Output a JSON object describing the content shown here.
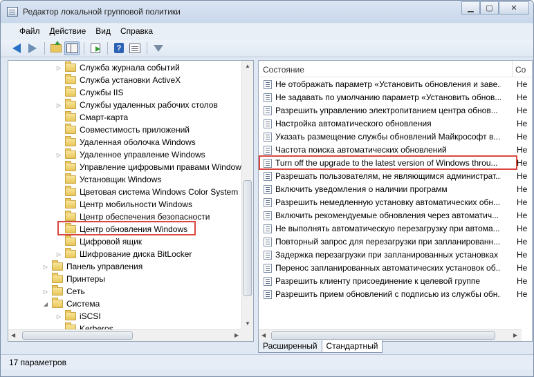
{
  "window": {
    "title": "Редактор локальной групповой политики",
    "minimize": "▁",
    "maximize": "▢",
    "close": "✕"
  },
  "menu": [
    "Файл",
    "Действие",
    "Вид",
    "Справка"
  ],
  "toolbar_icons": [
    "back-arrow-icon",
    "forward-arrow-icon",
    "up-folder-icon",
    "show-hide-tree-icon",
    "export-list-icon",
    "help-icon",
    "properties-icon",
    "filter-icon"
  ],
  "tree": [
    {
      "label": "Служба журнала событий",
      "expander": "▷"
    },
    {
      "label": "Служба установки ActiveX",
      "expander": ""
    },
    {
      "label": "Службы IIS",
      "expander": ""
    },
    {
      "label": "Службы удаленных рабочих столов",
      "expander": "▷"
    },
    {
      "label": "Смарт-карта",
      "expander": ""
    },
    {
      "label": "Совместимость приложений",
      "expander": ""
    },
    {
      "label": "Удаленная оболочка Windows",
      "expander": ""
    },
    {
      "label": "Удаленное управление Windows",
      "expander": "▷"
    },
    {
      "label": "Управление цифровыми правами Windows",
      "expander": ""
    },
    {
      "label": "Установщик Windows",
      "expander": ""
    },
    {
      "label": "Цветовая система Windows Color System",
      "expander": ""
    },
    {
      "label": "Центр мобильности Windows",
      "expander": ""
    },
    {
      "label": "Центр обеспечения безопасности",
      "expander": ""
    },
    {
      "label": "Центр обновления Windows",
      "expander": ""
    },
    {
      "label": "Цифровой ящик",
      "expander": ""
    },
    {
      "label": "Шифрование диска BitLocker",
      "expander": "▷"
    },
    {
      "label": "Панель управления",
      "expander": "▷"
    },
    {
      "label": "Принтеры",
      "expander": ""
    },
    {
      "label": "Сеть",
      "expander": "▷"
    },
    {
      "label": "Система",
      "expander": "◢"
    },
    {
      "label": "iSCSI",
      "expander": "▷"
    },
    {
      "label": "Kerberos",
      "expander": ""
    }
  ],
  "columns": {
    "name": "Состояние",
    "state": "Со"
  },
  "policies": [
    {
      "name": "Не отображать параметр «Установить обновления и заве...",
      "state": "Не"
    },
    {
      "name": "Не задавать по умолчанию параметр «Установить обнов...",
      "state": "Не"
    },
    {
      "name": "Разрешить управлению электропитанием центра обнов...",
      "state": "Не"
    },
    {
      "name": "Настройка автоматического обновления",
      "state": "Не"
    },
    {
      "name": "Указать размещение службы обновлений Майкрософт в...",
      "state": "Не"
    },
    {
      "name": "Частота поиска автоматических обновлений",
      "state": "Не"
    },
    {
      "name": "Turn off the upgrade to the latest version of Windows throu...",
      "state": "Не"
    },
    {
      "name": "Разрешать пользователям, не являющимся администрат...",
      "state": "Не"
    },
    {
      "name": "Включить уведомления о наличии программ",
      "state": "Не"
    },
    {
      "name": "Разрешить немедленную установку автоматических обн...",
      "state": "Не"
    },
    {
      "name": "Включить рекомендуемые обновления через автоматич...",
      "state": "Не"
    },
    {
      "name": "Не выполнять автоматическую перезагрузку при автома...",
      "state": "Не"
    },
    {
      "name": "Повторный запрос для перезагрузки при запланированн...",
      "state": "Не"
    },
    {
      "name": "Задержка перезагрузки при запланированных установках",
      "state": "Не"
    },
    {
      "name": "Перенос запланированных автоматических установок об...",
      "state": "Не"
    },
    {
      "name": "Разрешить клиенту присоединение к целевой группе",
      "state": "Не"
    },
    {
      "name": "Разрешить прием обновлений с подписью из службы обн...",
      "state": "Не"
    }
  ],
  "tabs": [
    "Расширенный",
    "Стандартный"
  ],
  "status": "17 параметров",
  "colors": {
    "highlight": "#d9453f",
    "window_bg": "#dfe8f3"
  }
}
